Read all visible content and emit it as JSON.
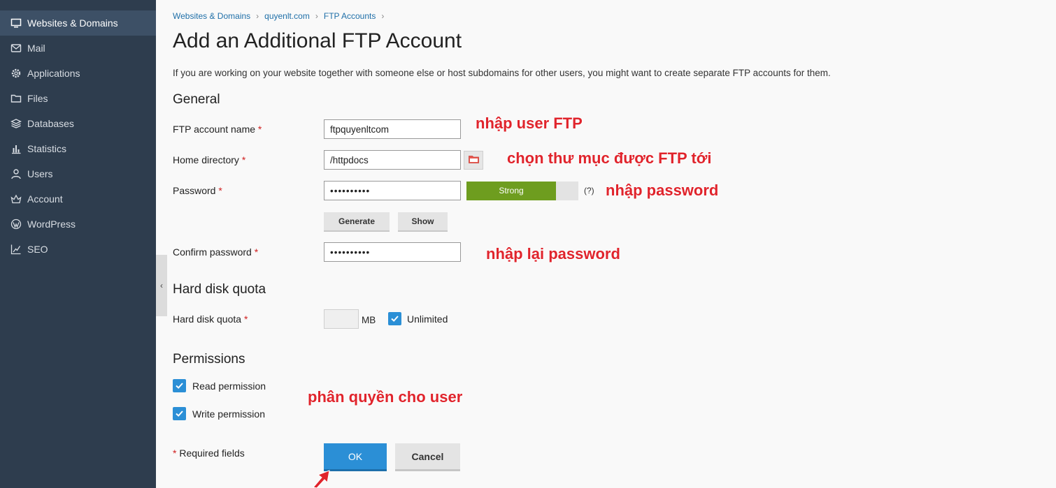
{
  "sidebar": {
    "items": [
      {
        "label": "Websites & Domains",
        "icon": "monitor-icon",
        "active": true
      },
      {
        "label": "Mail",
        "icon": "mail-icon"
      },
      {
        "label": "Applications",
        "icon": "gear-icon"
      },
      {
        "label": "Files",
        "icon": "folder-icon"
      },
      {
        "label": "Databases",
        "icon": "database-icon"
      },
      {
        "label": "Statistics",
        "icon": "bar-chart-icon"
      },
      {
        "label": "Users",
        "icon": "user-icon"
      },
      {
        "label": "Account",
        "icon": "account-icon"
      },
      {
        "label": "WordPress",
        "icon": "wordpress-icon"
      },
      {
        "label": "SEO",
        "icon": "seo-chart-icon"
      }
    ]
  },
  "breadcrumb": {
    "items": [
      "Websites & Domains",
      "quyenlt.com",
      "FTP Accounts"
    ],
    "separator": "›"
  },
  "page": {
    "title": "Add an Additional FTP Account",
    "intro": "If you are working on your website together with someone else or host subdomains for other users, you might want to create separate FTP accounts for them."
  },
  "general": {
    "heading": "General",
    "ftp_account_label": "FTP account name",
    "ftp_account_value": "ftpquyenltcom",
    "home_dir_label": "Home directory",
    "home_dir_value": "/httpdocs",
    "password_label": "Password",
    "password_value": "••••••••••",
    "strength_label": "Strength",
    "strength_text": "Strong",
    "strength_level": 0.8,
    "help_text": "(?)",
    "generate_label": "Generate",
    "show_label": "Show",
    "confirm_label": "Confirm password",
    "confirm_value": "••••••••••",
    "required_mark": "*"
  },
  "quota": {
    "heading": "Hard disk quota",
    "label": "Hard disk quota",
    "value": "",
    "unit": "MB",
    "unlimited_label": "Unlimited",
    "unlimited_checked": true
  },
  "permissions": {
    "heading": "Permissions",
    "read_label": "Read permission",
    "read_checked": true,
    "write_label": "Write permission",
    "write_checked": true
  },
  "footer": {
    "required_note": "Required fields",
    "required_mark": "*",
    "ok_label": "OK",
    "cancel_label": "Cancel"
  },
  "annotations": {
    "user_note": "nhập user FTP",
    "dir_note": "chọn thư mục được FTP tới",
    "password_note": "nhập password",
    "confirm_note": "nhập lại password",
    "permission_note": "phân quyền cho user"
  },
  "colors": {
    "sidebar_bg": "#2e3d4e",
    "sidebar_active": "#3d5066",
    "primary": "#2b8fd6",
    "strength": "#6e9d1f",
    "annotation": "#e0242c",
    "required": "#d02020"
  }
}
